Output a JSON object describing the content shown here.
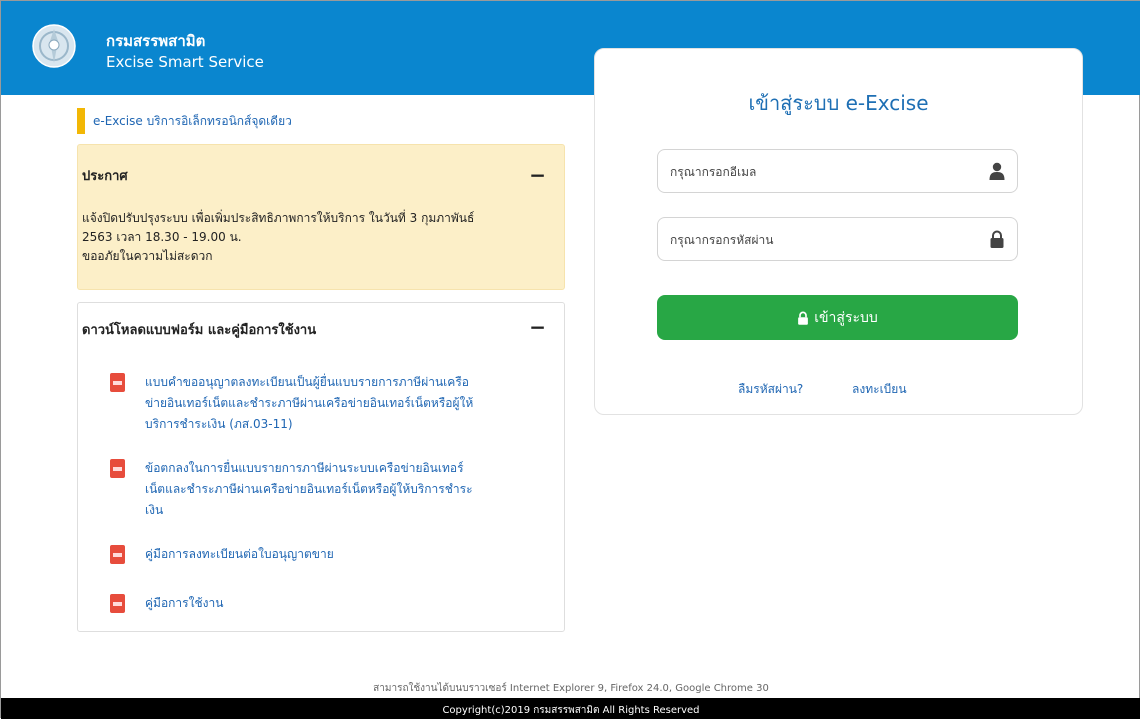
{
  "header": {
    "org_th": "กรมสรรพสามิต",
    "org_en": "Excise Smart Service",
    "logo_icon": "excise-emblem-icon"
  },
  "tagline": "e-Excise บริการอิเล็กทรอนิกส์จุดเดียว",
  "announcement": {
    "title": "ประกาศ",
    "collapse_symbol": "−",
    "lines": [
      "แจ้งปิดปรับปรุงระบบ เพื่อเพิ่มประสิทธิภาพการให้บริการ ในวันที่ 3 กุมภาพันธ์",
      "2563 เวลา 18.30 - 19.00 น.",
      "ขออภัยในความไม่สะดวก"
    ]
  },
  "downloads": {
    "title": "ดาวน์โหลดแบบฟอร์ม และคู่มือการใช้งาน",
    "collapse_symbol": "−",
    "items": [
      {
        "icon": "pdf-icon",
        "lines": [
          "แบบคำขออนุญาตลงทะเบียนเป็นผู้ยื่นแบบรายการภาษีผ่านเครือ",
          "ข่ายอินเทอร์เน็ตและชำระภาษีผ่านเครือข่ายอินเทอร์เน็ตหรือผู้ให้",
          "บริการชำระเงิน (ภส.03-11)"
        ]
      },
      {
        "icon": "pdf-icon",
        "lines": [
          "ข้อตกลงในการยื่นแบบรายการภาษีผ่านระบบเครือข่ายอินเทอร์",
          "เน็ตและชำระภาษีผ่านเครือข่ายอินเทอร์เน็ตหรือผู้ให้บริการชำระ",
          "เงิน"
        ]
      },
      {
        "icon": "pdf-icon",
        "lines": [
          "คู่มือการลงทะเบียนต่อใบอนุญาตขาย"
        ]
      },
      {
        "icon": "pdf-icon",
        "lines": [
          "คู่มือการใช้งาน"
        ]
      }
    ]
  },
  "login": {
    "title": "เข้าสู่ระบบ e-Excise",
    "email_placeholder": "กรุณากรอกอีเมล",
    "email_value": "",
    "email_icon": "user-icon",
    "password_placeholder": "กรุณากรอกรหัสผ่าน",
    "password_value": "",
    "password_icon": "lock-icon",
    "button_label": "เข้าสู่ระบบ",
    "button_icon": "lock-icon",
    "forgot_link": "ลืมรหัสผ่าน?",
    "register_link": "ลงทะเบียน"
  },
  "compat_note": "สามารถใช้งานได้บนบราวเซอร์ Internet Explorer 9, Firefox 24.0, Google Chrome 30",
  "copyright": "Copyright(c)2019 กรมสรรพสามิต All Rights Reserved",
  "colors": {
    "header_blue": "#0a86cf",
    "accent_yellow": "#f2b705",
    "announcement_bg": "#fcefc8",
    "link_blue": "#1f66b3",
    "login_green": "#28a745",
    "pdf_red": "#e74c3c"
  }
}
